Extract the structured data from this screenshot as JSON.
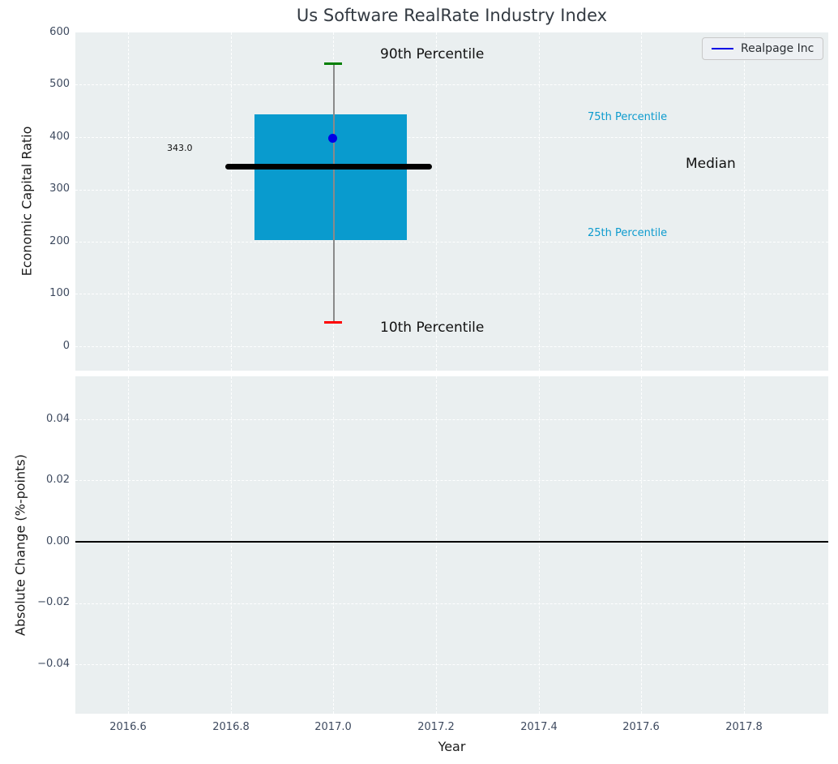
{
  "title": "Us Software RealRate Industry Index",
  "legend": {
    "label": "Realpage Inc"
  },
  "colors": {
    "box": "#099bce",
    "company_dot": "#0000e6",
    "p90_cap": "#007f00",
    "p10_cap": "#fe0000",
    "median_line": "#000000",
    "percentile_label": "#0d9bce",
    "plot_background": "#eaeff0"
  },
  "top_plot": {
    "ylabel": "Economic Capital Ratio",
    "yticks": [
      "600",
      "500",
      "400",
      "300",
      "200",
      "100",
      "0"
    ],
    "annotations": {
      "p90": "90th Percentile",
      "p75": "75th Percentile",
      "median": "Median",
      "median_value": "343.0",
      "p25": "25th Percentile",
      "p10": "10th Percentile"
    }
  },
  "bottom_plot": {
    "ylabel": "Absolute Change (%-points)",
    "yticks": [
      "0.04",
      "0.02",
      "0.00",
      "−0.02",
      "−0.04"
    ]
  },
  "x_axis": {
    "label": "Year",
    "ticks": [
      "2016.6",
      "2016.8",
      "2017.0",
      "2017.2",
      "2017.4",
      "2017.6",
      "2017.8"
    ]
  },
  "chart_data": [
    {
      "type": "box",
      "title": "Us Software RealRate Industry Index",
      "xlabel": "Year",
      "ylabel": "Economic Capital Ratio",
      "x": [
        2017.0
      ],
      "box": {
        "x": 2017.0,
        "p10": 45,
        "p25": 203,
        "median": 343,
        "p75": 443,
        "p90": 538,
        "median_label": "343.0",
        "box_width_years": 0.3,
        "median_line_width_years": 0.4
      },
      "series": [
        {
          "name": "Realpage Inc",
          "type": "point",
          "x": 2017.0,
          "y": 397,
          "color": "#0000e6"
        }
      ],
      "xlim": [
        2016.5,
        2017.96
      ],
      "ylim": [
        -48,
        600
      ],
      "xticks": [
        2016.6,
        2016.8,
        2017.0,
        2017.2,
        2017.4,
        2017.6,
        2017.8
      ],
      "yticks": [
        0,
        100,
        200,
        300,
        400,
        500,
        600
      ],
      "grid": true,
      "legend_position": "upper right"
    },
    {
      "type": "line",
      "xlabel": "Year",
      "ylabel": "Absolute Change (%-points)",
      "x": [],
      "series": [],
      "zero_line_y": 0.0,
      "xlim": [
        2016.5,
        2017.96
      ],
      "ylim": [
        -0.056,
        0.054
      ],
      "xticks": [
        2016.6,
        2016.8,
        2017.0,
        2017.2,
        2017.4,
        2017.6,
        2017.8
      ],
      "yticks": [
        0.04,
        0.02,
        0.0,
        -0.02,
        -0.04
      ],
      "grid": true
    }
  ]
}
